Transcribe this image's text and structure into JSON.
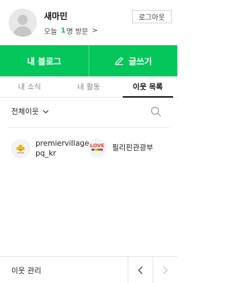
{
  "profile": {
    "nickname": "새마민",
    "visit_prefix": "오늘",
    "visit_count": "1",
    "visit_suffix": "명 방문",
    "visit_arrow": ">",
    "logout_label": "로그아웃"
  },
  "actions": {
    "my_blog_label": "내 블로그",
    "write_label": "글쓰기"
  },
  "tabs": [
    {
      "label": "내 소식",
      "active": false
    },
    {
      "label": "내 활동",
      "active": false
    },
    {
      "label": "이웃 목록",
      "active": true
    }
  ],
  "filter": {
    "label": "전체이웃"
  },
  "neighbors": [
    {
      "name": "premiervillagepq_kr",
      "icon": "premier-village-logo"
    },
    {
      "name": "필리핀관광부",
      "icon": "love-the-philippines-logo"
    }
  ],
  "footer": {
    "manage_label": "이웃 관리"
  },
  "colors": {
    "accent": "#03c75a",
    "logo_yellow": "#f1b500"
  }
}
